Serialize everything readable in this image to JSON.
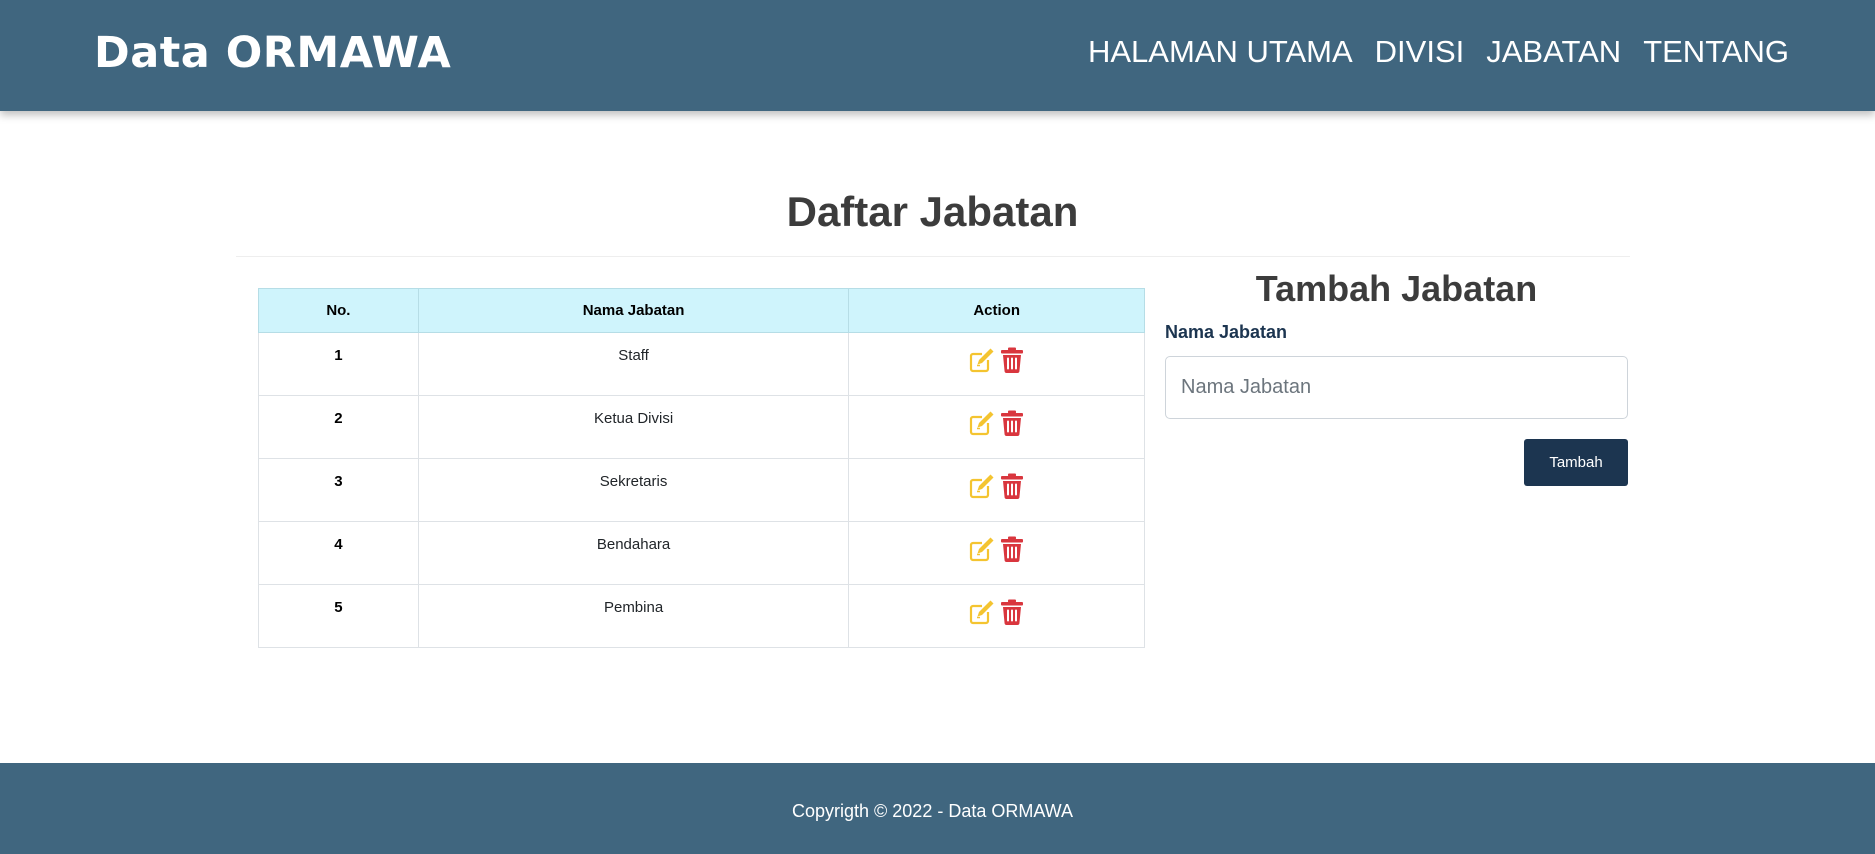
{
  "brand": "Data ORMAWA",
  "nav": [
    {
      "label": "HALAMAN UTAMA"
    },
    {
      "label": "DIVISI"
    },
    {
      "label": "JABATAN"
    },
    {
      "label": "TENTANG"
    }
  ],
  "page_title": "Daftar Jabatan",
  "table": {
    "headers": [
      "No.",
      "Nama Jabatan",
      "Action"
    ],
    "rows": [
      {
        "no": "1",
        "nama": "Staff"
      },
      {
        "no": "2",
        "nama": "Ketua Divisi"
      },
      {
        "no": "3",
        "nama": "Sekretaris"
      },
      {
        "no": "4",
        "nama": "Bendahara"
      },
      {
        "no": "5",
        "nama": "Pembina"
      }
    ],
    "action_icons": [
      "edit-icon",
      "trash-icon"
    ]
  },
  "form": {
    "title": "Tambah Jabatan",
    "label": "Nama Jabatan",
    "input_value": "",
    "placeholder": "Nama Jabatan",
    "submit_label": "Tambah"
  },
  "footer": {
    "copyright": "Copyrigth © 2022 - Data ORMAWA"
  },
  "colors": {
    "navbar": "#40667f",
    "header_row": "#cff4fc",
    "edit_icon": "#f4c430",
    "delete_icon": "#d9363e",
    "submit_button": "#1c3550"
  }
}
